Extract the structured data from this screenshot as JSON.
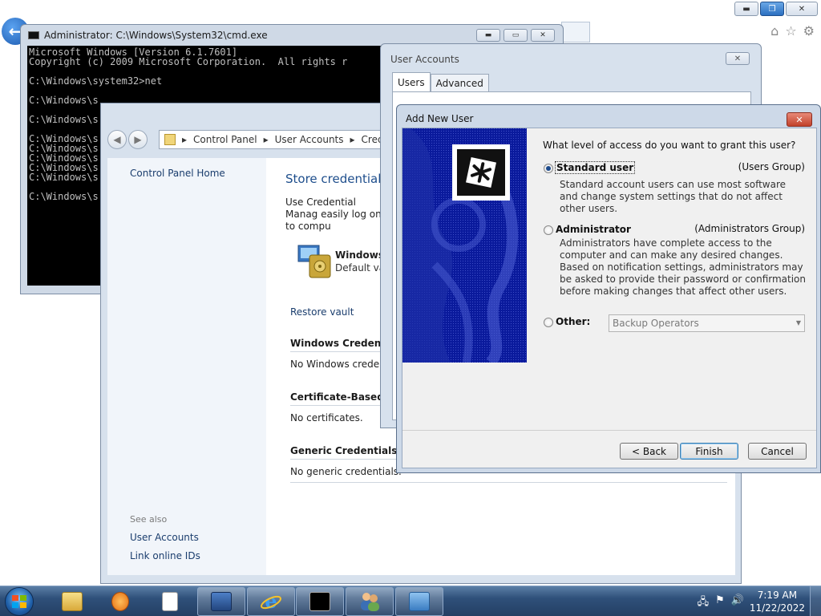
{
  "ie": {
    "caption": {
      "minimize": "▬",
      "restore": "❐",
      "close": "✕"
    },
    "back_glyph": "←",
    "toolbar_icons": {
      "home": "⌂",
      "favorites": "☆",
      "tools": "⚙"
    }
  },
  "cmd": {
    "title": "Administrator: C:\\Windows\\System32\\cmd.exe",
    "buttons": {
      "minimize": "▬",
      "maximize": "▭",
      "close": "✕"
    },
    "lines": [
      "Microsoft Windows [Version 6.1.7601]",
      "Copyright (c) 2009 Microsoft Corporation.  All rights r",
      "",
      "C:\\Windows\\system32>net",
      "",
      "C:\\Windows\\s",
      "",
      "C:\\Windows\\s",
      "",
      "C:\\Windows\\s",
      "C:\\Windows\\s",
      "C:\\Windows\\s",
      "C:\\Windows\\s",
      "C:\\Windows\\s",
      "",
      "C:\\Windows\\s"
    ]
  },
  "control_panel": {
    "nav": {
      "back": "◀",
      "forward": "▶"
    },
    "breadcrumb": {
      "sep1": "▸",
      "item1": "Control Panel",
      "sep2": "▸",
      "item2": "User Accounts",
      "sep3": "▸",
      "item3": "Creden"
    },
    "left": {
      "home": "Control Panel Home",
      "see_also": "See also",
      "user_accounts": "User Accounts",
      "link_ids": "Link online IDs"
    },
    "heading": "Store credentials",
    "desc": "Use Credential Manag easily log on to compu",
    "vault_title": "Windows V",
    "vault_sub": "Default vau",
    "restore_vault": "Restore vault",
    "sections": [
      {
        "head": "Windows Credential",
        "text": "No Windows credent"
      },
      {
        "head": "Certificate-Based cr",
        "text": "No certificates."
      },
      {
        "head": "Generic Credentials",
        "text": "No generic credentials."
      }
    ]
  },
  "user_accounts": {
    "title": "User Accounts",
    "close": "✕",
    "tabs": [
      {
        "label": "Users"
      },
      {
        "label": "Advanced"
      }
    ]
  },
  "add_new_user": {
    "title": "Add New User",
    "close": "✕",
    "question": "What level of access do you want to grant this user?",
    "options": {
      "standard": {
        "label": "Standard user",
        "group": "(Users Group)",
        "desc": "Standard account users can use most software and change system settings that do not affect other users.",
        "selected": true
      },
      "admin": {
        "label": "Administrator",
        "group": "(Administrators Group)",
        "desc": "Administrators have complete access to the computer and can make any desired changes. Based on notification settings, administrators may be asked to provide their password or confirmation before making changes that affect other users."
      },
      "other": {
        "label": "Other:",
        "value": "Backup Operators"
      }
    },
    "dropdown_arrow": "▼",
    "buttons": {
      "back": "< Back",
      "finish": "Finish",
      "cancel": "Cancel"
    }
  },
  "taskbar": {
    "tray": {
      "network": "🖧",
      "flag": "⚑",
      "volume": "🔊"
    },
    "time": "7:19 AM",
    "date": "11/22/2022"
  }
}
